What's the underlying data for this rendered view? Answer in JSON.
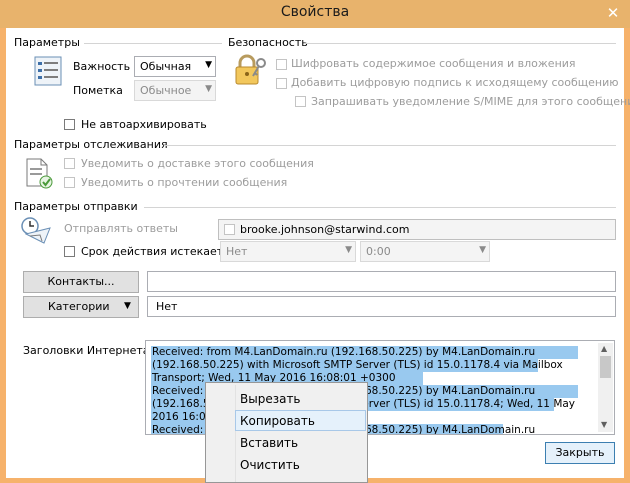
{
  "window": {
    "title": "Свойства",
    "close_glyph": "✕"
  },
  "settings": {
    "heading": "Параметры",
    "importance_label": "Важность",
    "importance_value": "Обычная",
    "sensitivity_label": "Пометка",
    "sensitivity_value": "Обычное",
    "no_autoarchive_label": "Не автоархивировать"
  },
  "security": {
    "heading": "Безопасность",
    "encrypt_label": "Шифровать содержимое сообщения и вложения",
    "sign_label": "Добавить цифровую подпись к исходящему сообщению",
    "smime_label": "Запрашивать уведомление S/MIME для этого сообщения"
  },
  "tracking": {
    "heading": "Параметры отслеживания",
    "delivery_label": "Уведомить о доставке этого сообщения",
    "read_label": "Уведомить о прочтении сообщения"
  },
  "delivery": {
    "heading": "Параметры отправки",
    "reply_to_label": "Отправлять ответы",
    "reply_to_value": "brooke.johnson@starwind.com",
    "expires_label": "Срок действия истекает",
    "expires_date": "Нет",
    "expires_time": "0:00"
  },
  "contacts": {
    "button_label": "Контакты...",
    "value": ""
  },
  "categories": {
    "button_label": "Категории",
    "value": "Нет"
  },
  "headers": {
    "label": "Заголовки Интернета",
    "lines": [
      "Received: from M4.LanDomain.ru (192.168.50.225) by M4.LanDomain.ru",
      " (192.168.50.225) with Microsoft SMTP Server (TLS) id 15.0.1178.4 via Mailbox",
      " Transport; Wed, 11 May 2016 16:08:01 +0300",
      "Received: from M4.LanDomain.ru (192.168.50.225) by M4.LanDomain.ru",
      " (192.168.50.225) with Microsoft SMTP Server (TLS) id 15.0.1178.4; Wed, 11 May",
      " 2016 16:08:01 +0300",
      "Received: from M4.LanDomain.ru (192.168.50.225) by M4.LanDomain.ru"
    ]
  },
  "context_menu": {
    "items": [
      "Вырезать",
      "Копировать",
      "Вставить",
      "Очистить"
    ],
    "highlighted": "Копировать"
  },
  "close_button_label": "Закрыть"
}
